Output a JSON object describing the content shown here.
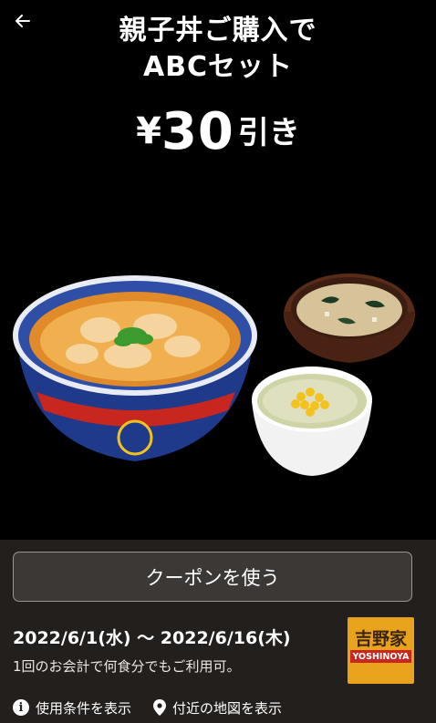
{
  "header": {
    "back_icon": "arrow-left-icon",
    "title_line1": "親子丼ご購入で",
    "title_line2": "ABCセット"
  },
  "offer": {
    "currency": "¥",
    "amount": "30",
    "suffix": "引き"
  },
  "coupon": {
    "use_button_label": "クーポンを使う",
    "period": "2022/6/1(水) 〜 2022/6/16(木)",
    "note": "1回のお会計で何食分でもご利用可。",
    "brand_kanji": "吉野家",
    "brand_roman": "YOSHINOYA"
  },
  "footer_links": [
    {
      "icon": "info-icon",
      "label": "使用条件を表示"
    },
    {
      "icon": "map-pin-icon",
      "label": "付近の地図を表示"
    }
  ],
  "colors": {
    "background": "#000000",
    "panel": "#231f1c",
    "button_fill": "#3b3836",
    "brand_orange": "#e8a21b",
    "brand_red": "#c8271f"
  }
}
